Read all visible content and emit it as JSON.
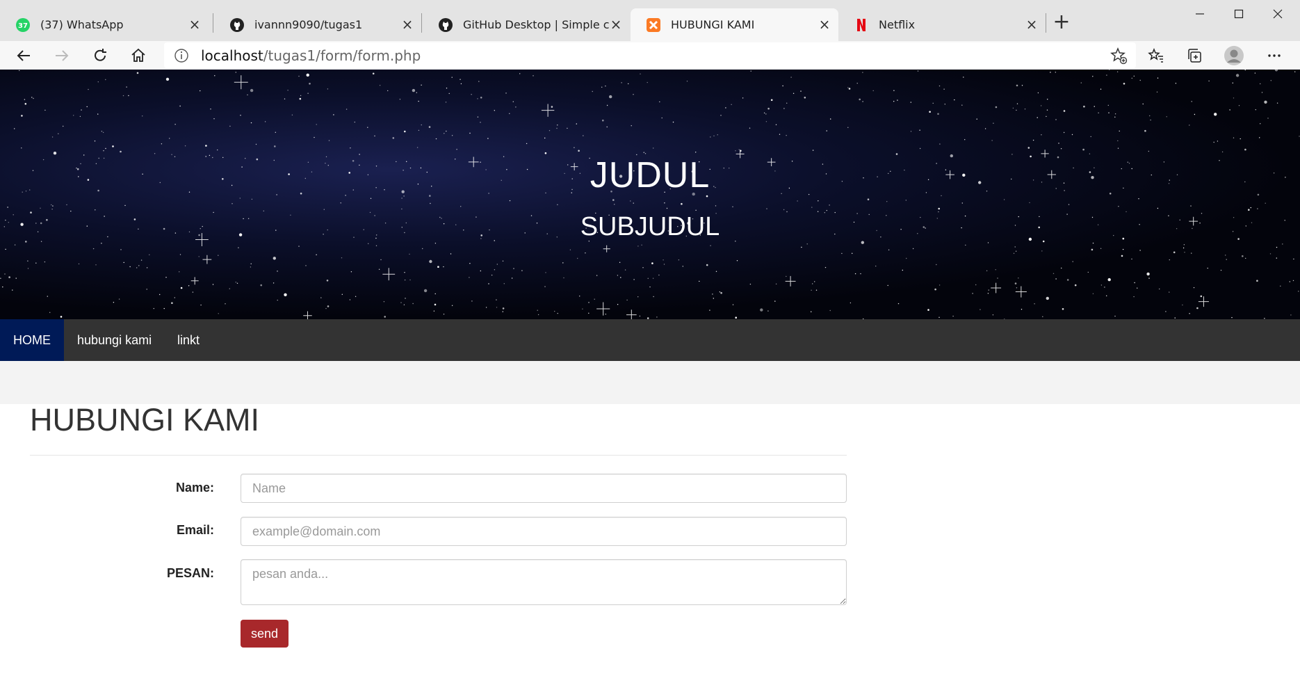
{
  "browser": {
    "tabs": [
      {
        "title": "(37) WhatsApp",
        "icon": "whatsapp-icon",
        "badge": "37",
        "active": false
      },
      {
        "title": "ivannn9090/tugas1",
        "icon": "github-icon",
        "active": false
      },
      {
        "title": "GitHub Desktop | Simple collabo",
        "icon": "github-icon",
        "active": false
      },
      {
        "title": "HUBUNGI KAMI",
        "icon": "xampp-icon",
        "active": true
      },
      {
        "title": "Netflix",
        "icon": "netflix-icon",
        "active": false
      }
    ],
    "address": {
      "host": "localhost",
      "path": "/tugas1/form/form.php"
    }
  },
  "hero": {
    "title": "JUDUL",
    "subtitle": "SUBJUDUL"
  },
  "nav": {
    "items": [
      {
        "label": "HOME",
        "active": true
      },
      {
        "label": "hubungi kami",
        "active": false
      },
      {
        "label": "linkt",
        "active": false
      }
    ]
  },
  "main": {
    "heading": "HUBUNGI KAMI",
    "form": {
      "name_label": "Name:",
      "name_placeholder": "Name",
      "email_label": "Email:",
      "email_placeholder": "example@domain.com",
      "message_label": "PESAN:",
      "message_placeholder": "pesan anda...",
      "submit_label": "send"
    }
  },
  "colors": {
    "nav_bg": "#333333",
    "nav_active": "#001a57",
    "button": "#a8282b"
  }
}
